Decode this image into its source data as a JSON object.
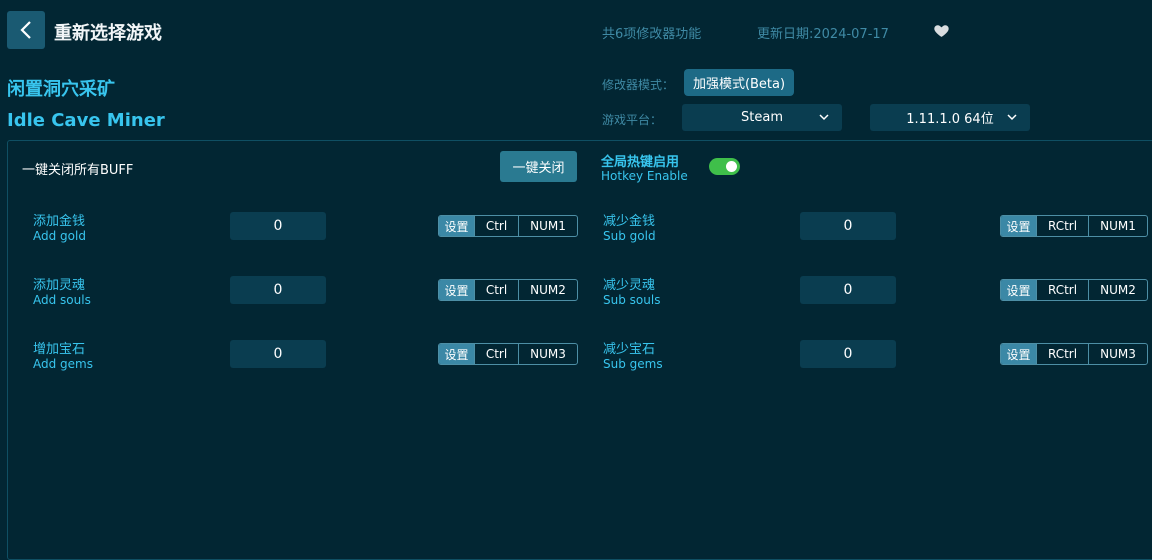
{
  "header": {
    "back_title": "重新选择游戏",
    "feature_count": "共6项修改器功能",
    "update_date": "更新日期:2024-07-17"
  },
  "game": {
    "name_cn": "闲置洞穴采矿",
    "name_en": "Idle Cave Miner"
  },
  "settings": {
    "mode_label": "修改器模式：",
    "mode_value": "加强模式(Beta)",
    "platform_label": "游戏平台：",
    "platform_value": "Steam",
    "version_value": "1.11.1.0 64位"
  },
  "controls": {
    "disable_all_label": "一键关闭所有BUFF",
    "close_all_button": "一键关闭",
    "hotkey_cn": "全局热键启用",
    "hotkey_en": "Hotkey Enable",
    "hotkey_enabled": true
  },
  "options": [
    {
      "cn": "添加金钱",
      "en": "Add gold",
      "value": "0",
      "set": "设置",
      "mod": "Ctrl",
      "key": "NUM1"
    },
    {
      "cn": "减少金钱",
      "en": "Sub gold",
      "value": "0",
      "set": "设置",
      "mod": "RCtrl",
      "key": "NUM1"
    },
    {
      "cn": "添加灵魂",
      "en": "Add souls",
      "value": "0",
      "set": "设置",
      "mod": "Ctrl",
      "key": "NUM2"
    },
    {
      "cn": "减少灵魂",
      "en": "Sub souls",
      "value": "0",
      "set": "设置",
      "mod": "RCtrl",
      "key": "NUM2"
    },
    {
      "cn": "增加宝石",
      "en": "Add gems",
      "value": "0",
      "set": "设置",
      "mod": "Ctrl",
      "key": "NUM3"
    },
    {
      "cn": "减少宝石",
      "en": "Sub gems",
      "value": "0",
      "set": "设置",
      "mod": "RCtrl",
      "key": "NUM3"
    }
  ],
  "icons": [
    "back-icon",
    "heart-icon",
    "chevron-down-icon"
  ]
}
